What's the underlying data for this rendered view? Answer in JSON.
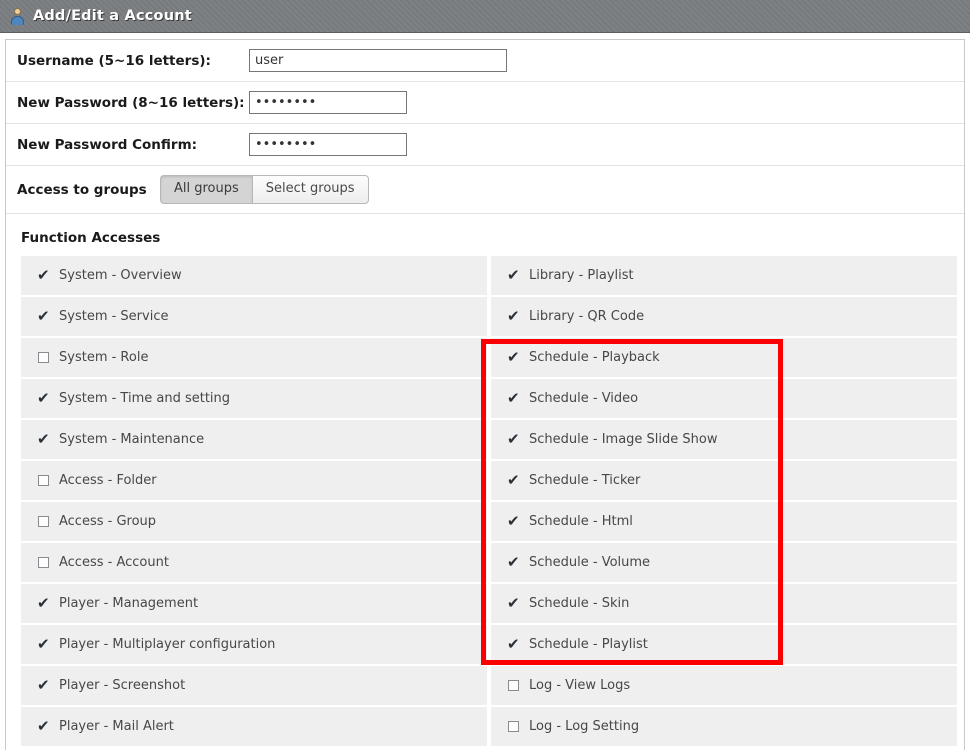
{
  "window": {
    "title": "Add/Edit a Account",
    "icon": "user-account-icon"
  },
  "form": {
    "username": {
      "label": "Username (5~16 letters):",
      "value": "user",
      "placeholder": ""
    },
    "new_password": {
      "label": "New Password (8~16 letters):",
      "value": "••••••••",
      "placeholder": ""
    },
    "new_password_confirm": {
      "label": "New Password Confirm:",
      "value": "••••••••",
      "placeholder": ""
    },
    "access_to_groups": {
      "label": "Access to groups",
      "options": [
        "All groups",
        "Select groups"
      ],
      "selected": "All groups"
    }
  },
  "function_accesses": {
    "title": "Function Accesses",
    "left_column": [
      {
        "label": "System - Overview",
        "checked": true
      },
      {
        "label": "System - Service",
        "checked": true
      },
      {
        "label": "System - Role",
        "checked": false
      },
      {
        "label": "System - Time and setting",
        "checked": true
      },
      {
        "label": "System - Maintenance",
        "checked": true
      },
      {
        "label": "Access - Folder",
        "checked": false
      },
      {
        "label": "Access - Group",
        "checked": false
      },
      {
        "label": "Access - Account",
        "checked": false
      },
      {
        "label": "Player - Management",
        "checked": true
      },
      {
        "label": "Player - Multiplayer configuration",
        "checked": true
      },
      {
        "label": "Player - Screenshot",
        "checked": true
      },
      {
        "label": "Player - Mail Alert",
        "checked": true
      }
    ],
    "right_column": [
      {
        "label": "Library - Playlist",
        "checked": true
      },
      {
        "label": "Library - QR Code",
        "checked": true
      },
      {
        "label": "Schedule - Playback",
        "checked": true
      },
      {
        "label": "Schedule - Video",
        "checked": true
      },
      {
        "label": "Schedule - Image Slide Show",
        "checked": true
      },
      {
        "label": "Schedule - Ticker",
        "checked": true
      },
      {
        "label": "Schedule - Html",
        "checked": true
      },
      {
        "label": "Schedule - Volume",
        "checked": true
      },
      {
        "label": "Schedule - Skin",
        "checked": true
      },
      {
        "label": "Schedule - Playlist",
        "checked": true
      },
      {
        "label": "Log - View Logs",
        "checked": false
      },
      {
        "label": "Log - Log Setting",
        "checked": false
      }
    ]
  },
  "annotation": {
    "highlight_color": "#fb0000",
    "highlight_covers": [
      "Schedule - Playback",
      "Schedule - Video",
      "Schedule - Image Slide Show",
      "Schedule - Ticker",
      "Schedule - Html",
      "Schedule - Volume",
      "Schedule - Skin",
      "Schedule - Playlist"
    ]
  }
}
